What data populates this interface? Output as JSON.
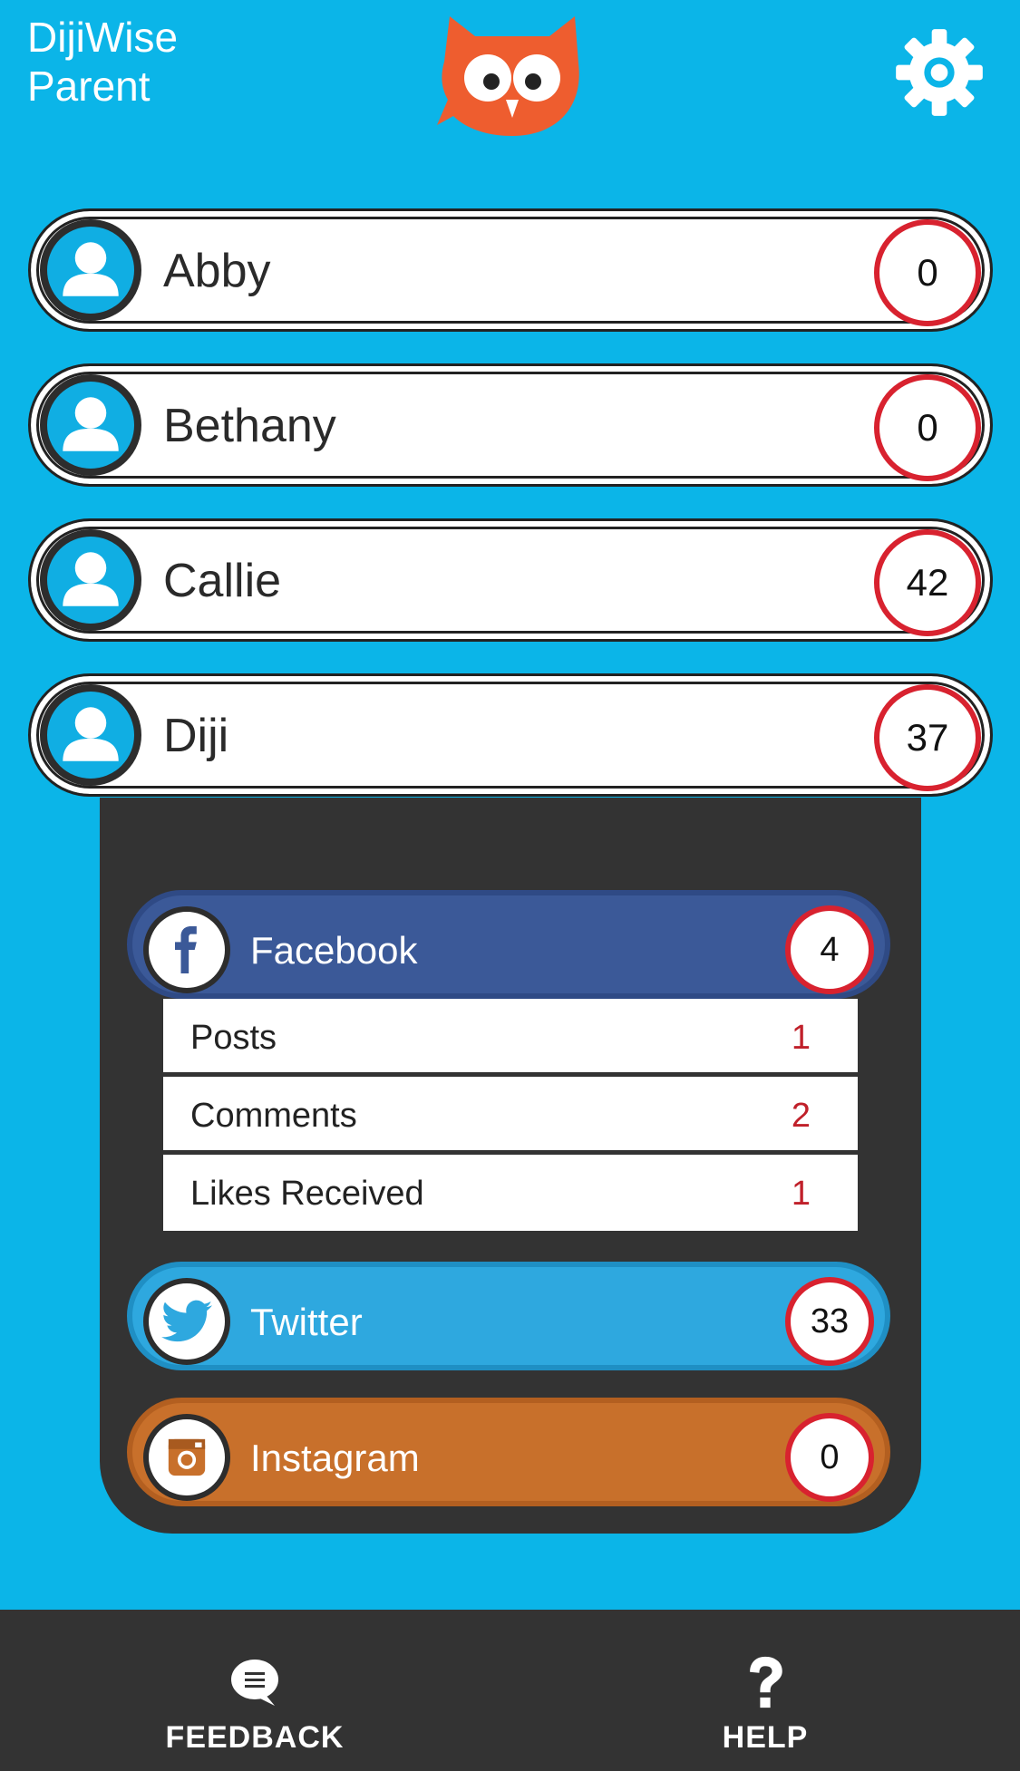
{
  "header": {
    "title_line1": "DijiWise",
    "title_line2": "Parent",
    "logo_icon": "owl-logo",
    "settings_icon": "gear-icon"
  },
  "children": [
    {
      "name": "Abby",
      "count": "0"
    },
    {
      "name": "Bethany",
      "count": "0"
    },
    {
      "name": "Callie",
      "count": "42"
    },
    {
      "name": "Diji",
      "count": "37"
    }
  ],
  "expanded_child": {
    "networks": [
      {
        "name": "Facebook",
        "count": "4",
        "color": "#3b5998",
        "icon": "facebook-icon",
        "stats": [
          {
            "label": "Posts",
            "value": "1"
          },
          {
            "label": "Comments",
            "value": "2"
          },
          {
            "label": "Likes Received",
            "value": "1"
          }
        ]
      },
      {
        "name": "Twitter",
        "count": "33",
        "color": "#2ea8df",
        "icon": "twitter-icon"
      },
      {
        "name": "Instagram",
        "count": "0",
        "color": "#c8702b",
        "icon": "instagram-icon"
      }
    ]
  },
  "bottom_nav": {
    "feedback_label": "FEEDBACK",
    "help_label": "HELP"
  },
  "colors": {
    "background": "#0bb5e8",
    "badge_ring": "#d8222f",
    "dark_panel": "#333333"
  }
}
